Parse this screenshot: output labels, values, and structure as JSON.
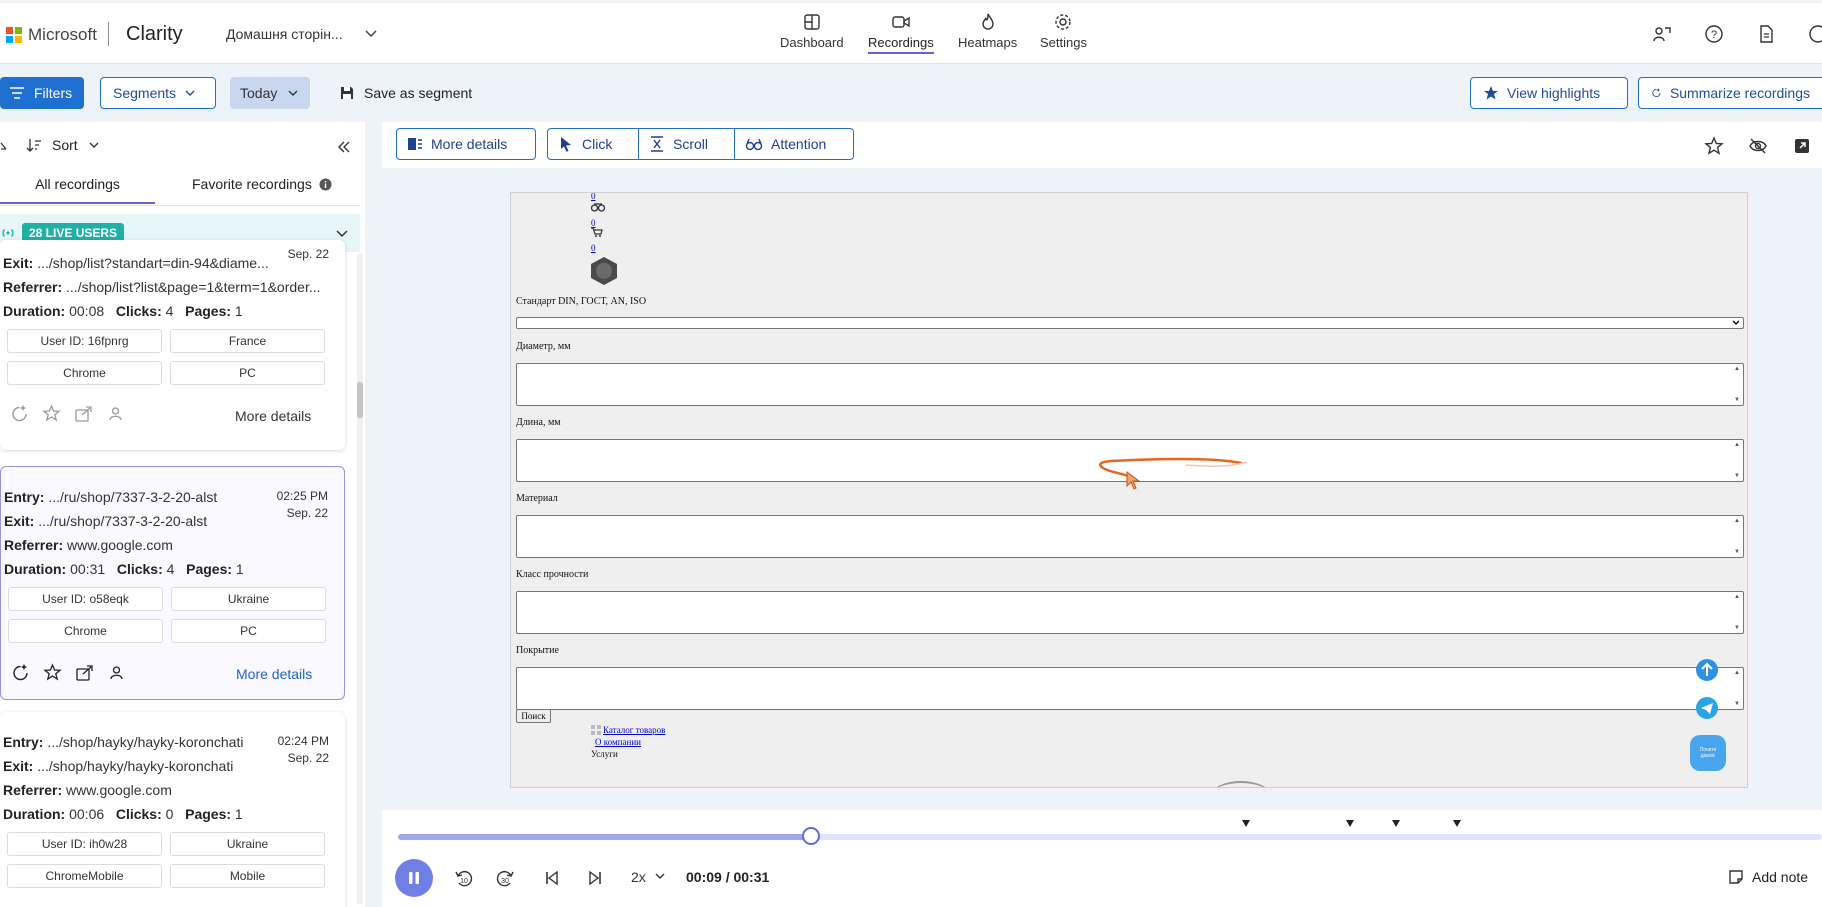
{
  "header": {
    "brand_ms": "Microsoft",
    "brand_app": "Clarity",
    "project": "Домашня сторін...",
    "nav": [
      {
        "label": "Dashboard",
        "icon": "dashboard-icon"
      },
      {
        "label": "Recordings",
        "icon": "video-camera-icon",
        "active": true
      },
      {
        "label": "Heatmaps",
        "icon": "flame-icon"
      },
      {
        "label": "Settings",
        "icon": "gear-icon"
      }
    ],
    "right_icons": [
      "user-share-icon",
      "help-icon",
      "document-icon"
    ]
  },
  "filterbar": {
    "filters": "Filters",
    "segments": "Segments",
    "date": "Today",
    "save_segment": "Save as segment",
    "view_highlights": "View highlights",
    "summarize": "Summarize recordings"
  },
  "sidebar": {
    "sort": "Sort",
    "tabs": [
      "All recordings",
      "Favorite recordings"
    ],
    "live": "28 LIVE USERS",
    "sessions": [
      {
        "entry": "",
        "exit": ".../shop/list?standart=din-94&diame...",
        "referrer": ".../shop/list?list&page=1&term=1&order...",
        "duration": "00:08",
        "clicks": "4",
        "pages": "1",
        "time": "",
        "date": "Sep. 22",
        "user_id": "User ID: 16fpnrg",
        "country": "France",
        "browser": "Chrome",
        "device": "PC",
        "more": "More details"
      },
      {
        "entry": ".../ru/shop/7337-3-2-20-alst",
        "exit": ".../ru/shop/7337-3-2-20-alst",
        "referrer": "www.google.com",
        "duration": "00:31",
        "clicks": "4",
        "pages": "1",
        "time": "02:25 PM",
        "date": "Sep. 22",
        "user_id": "User ID: o58eqk",
        "country": "Ukraine",
        "browser": "Chrome",
        "device": "PC",
        "more": "More details"
      },
      {
        "entry": ".../shop/hayky/hayky-koronchati",
        "exit": ".../shop/hayky/hayky-koronchati",
        "referrer": "www.google.com",
        "duration": "00:06",
        "clicks": "0",
        "pages": "1",
        "time": "02:24 PM",
        "date": "Sep. 22",
        "user_id": "User ID: ih0w28",
        "country": "Ukraine",
        "browser": "ChromeMobile",
        "device": "Mobile",
        "more": ""
      }
    ],
    "labels": {
      "entry": "Entry:",
      "exit": "Exit:",
      "referrer": "Referrer:",
      "duration": "Duration:",
      "clicks": "Clicks:",
      "pages": "Pages:"
    }
  },
  "toolbar": {
    "more_details": "More details",
    "click": "Click",
    "scroll": "Scroll",
    "attention": "Attention"
  },
  "recording": {
    "links": [
      "0",
      "0",
      "0"
    ],
    "standard_label": "Стандарт DIN, ГОСТ, AN, ISO",
    "fields": [
      "Диаметр, мм",
      "Длина, мм",
      "Материал",
      "Класс прочности",
      "Покрытие"
    ],
    "search_button": "Поиск",
    "footer_links": [
      "Каталог товаров",
      "О компании"
    ],
    "footer_text": "Услуги",
    "chat_widget": "Почати діалог"
  },
  "player": {
    "progress": 0.29,
    "speed": "2x",
    "elapsed": "00:09",
    "total": "00:31",
    "time_display": "00:09 / 00:31",
    "skip_back": "10",
    "skip_forward": "30",
    "add_note": "Add note",
    "accent": "#6f7fe3"
  }
}
